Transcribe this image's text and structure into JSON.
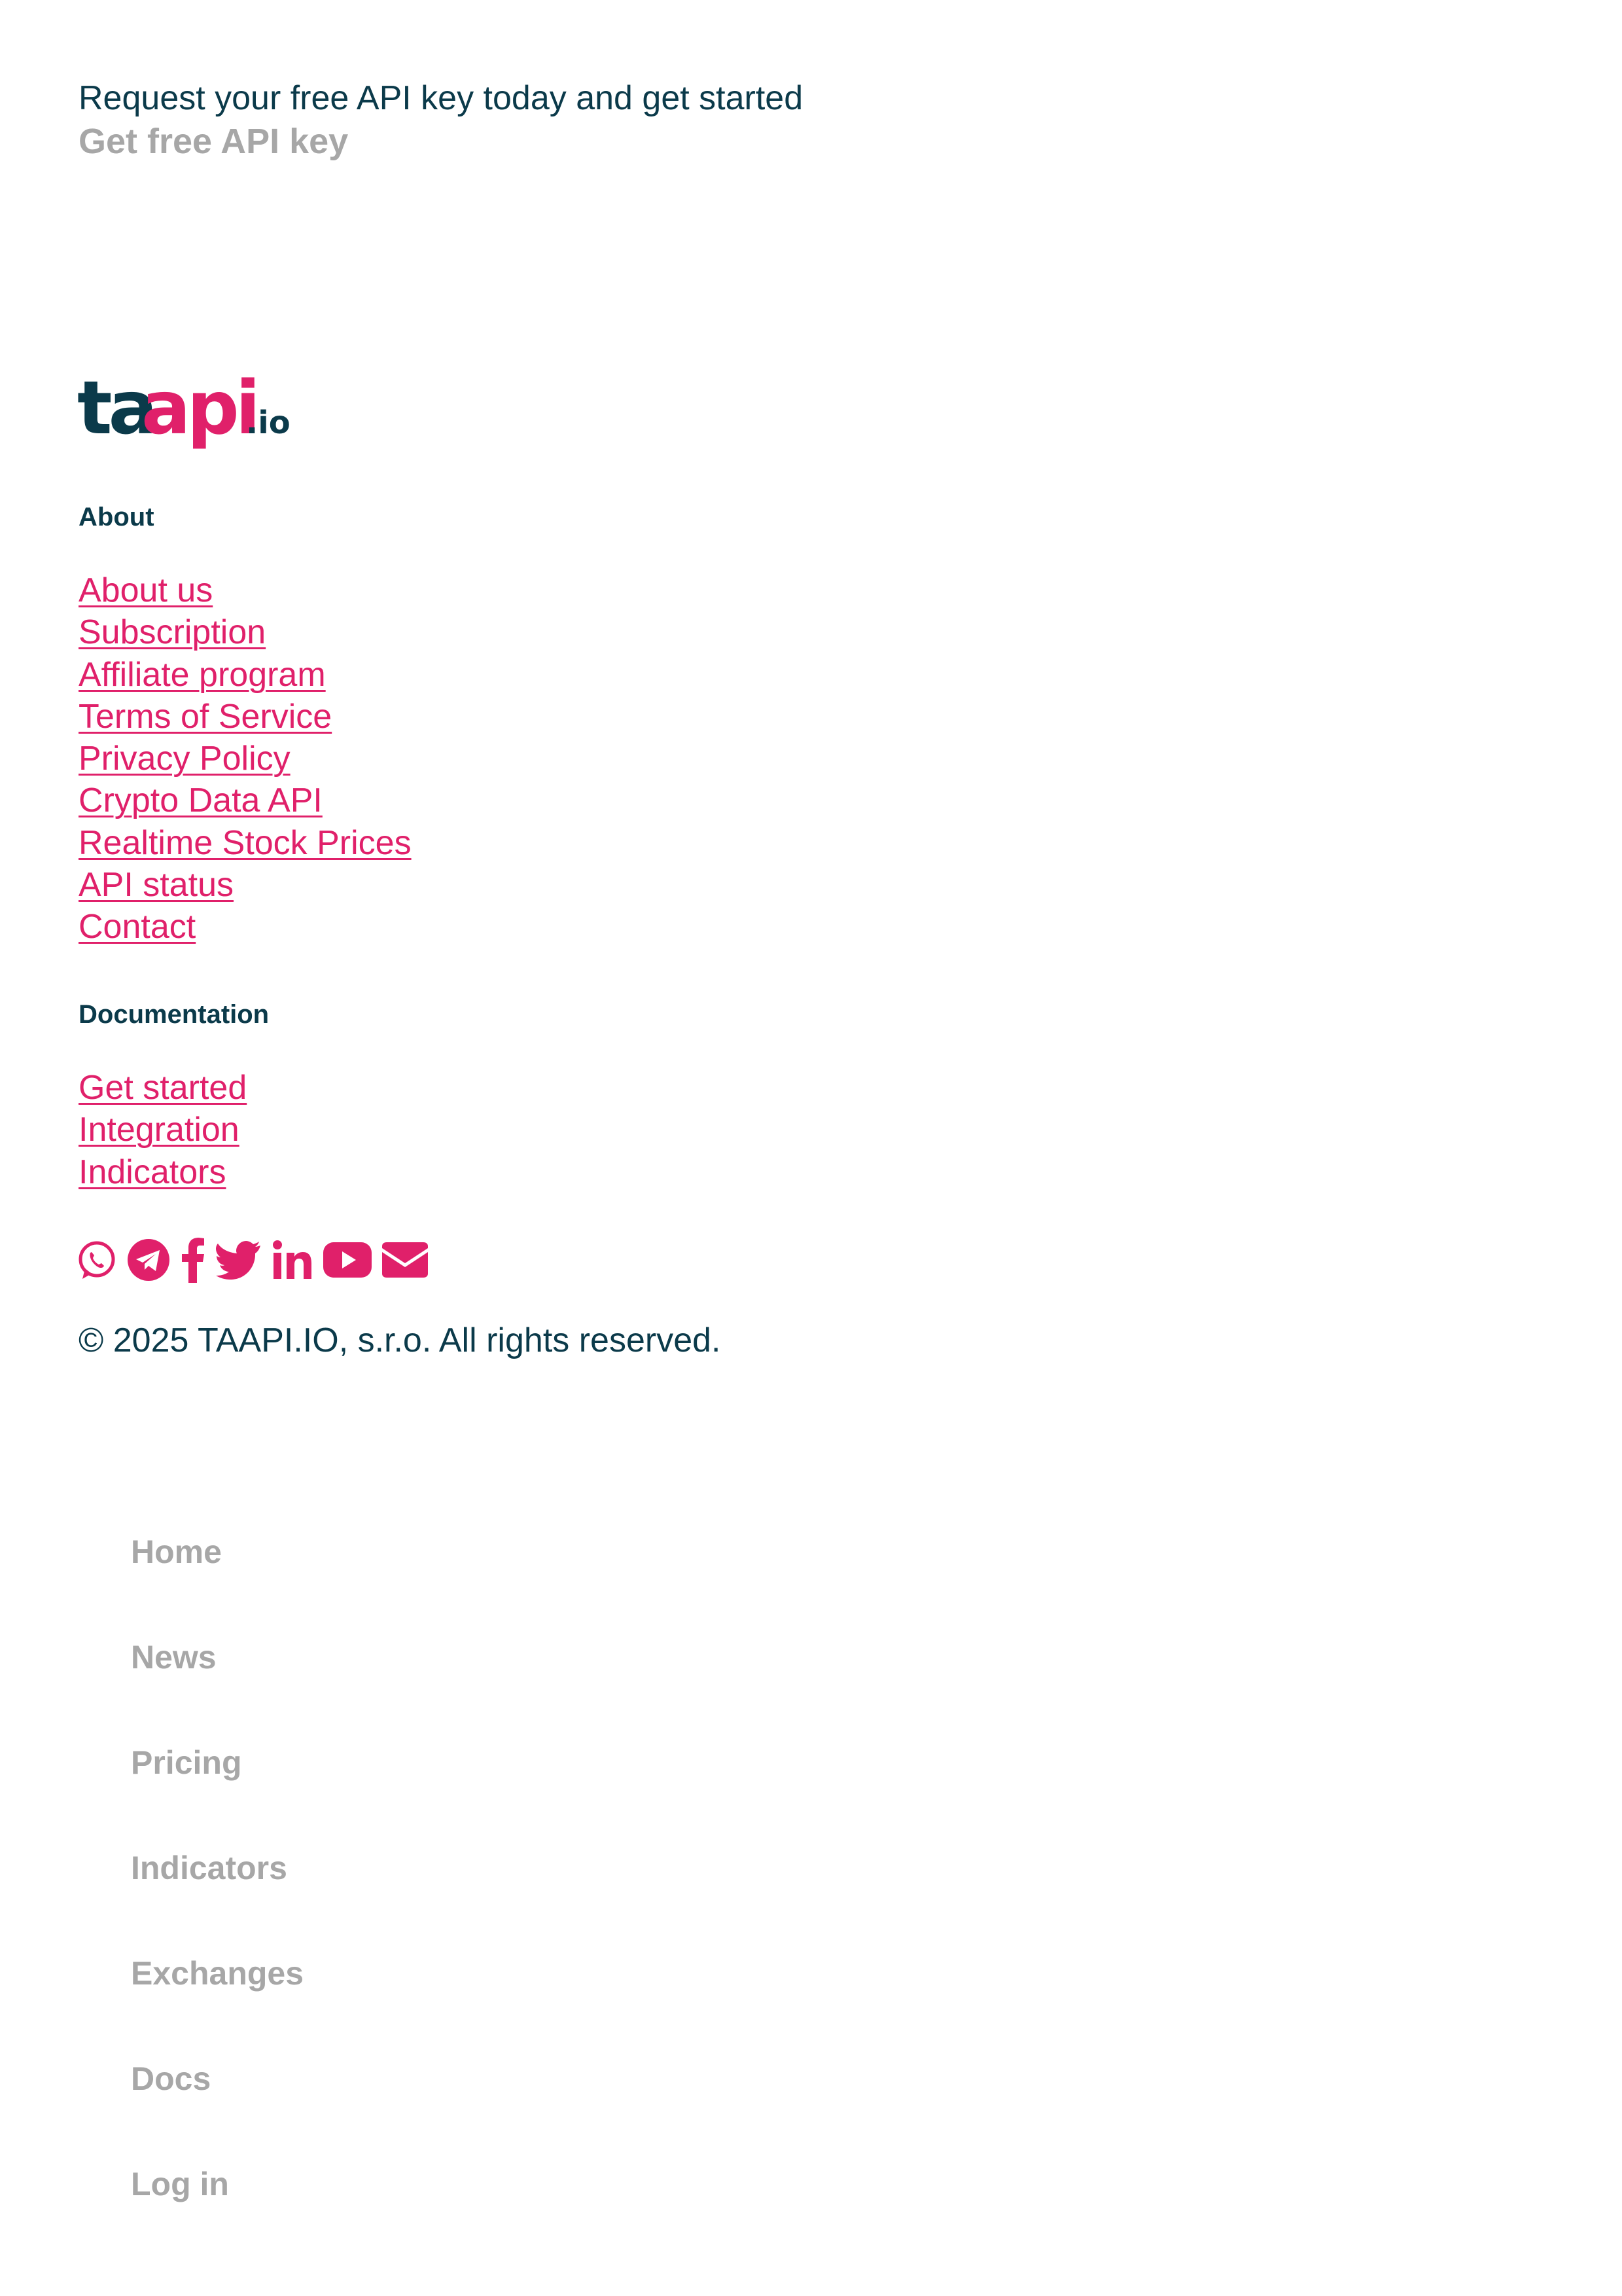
{
  "cta": {
    "text": "Request your free API key today and get started",
    "button_label": "Get free API key"
  },
  "logo": {
    "text_dark": "ta",
    "text_pink": "api",
    "text_suffix": ".io"
  },
  "footer": {
    "about_heading": "About",
    "about_links": [
      "About us",
      "Subscription",
      "Affiliate program",
      "Terms of Service",
      "Privacy Policy",
      "Crypto Data API",
      "Realtime Stock Prices",
      "API status",
      "Contact"
    ],
    "docs_heading": "Documentation",
    "docs_links": [
      "Get started",
      "Integration",
      "Indicators"
    ],
    "social_icons": [
      "whatsapp-icon",
      "telegram-icon",
      "facebook-icon",
      "twitter-icon",
      "linkedin-icon",
      "youtube-icon",
      "envelope-icon"
    ],
    "copyright": "© 2025 TAAPI.IO, s.r.o. All rights reserved."
  },
  "menu": {
    "items": [
      "Home",
      "News",
      "Pricing",
      "Indicators",
      "Exchanges",
      "Docs",
      "Log in"
    ]
  },
  "colors": {
    "brand_pink": "#e0206a",
    "brand_dark": "#0b3a4a",
    "muted_gray": "#a7a7a7"
  }
}
